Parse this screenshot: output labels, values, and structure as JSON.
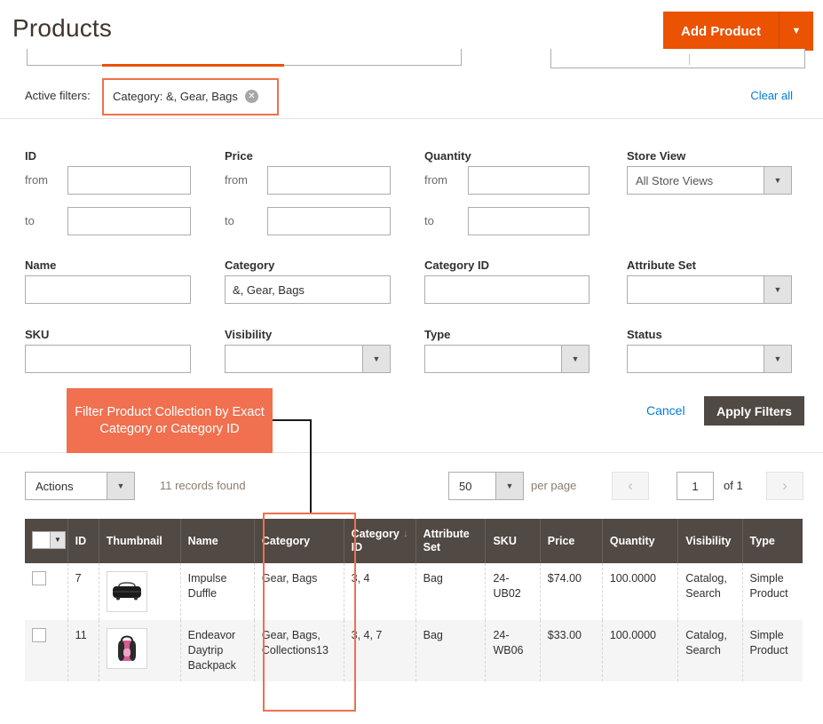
{
  "header": {
    "title": "Products",
    "add_product_label": "Add Product",
    "caret_icon": "chevron-down-icon"
  },
  "active_filters": {
    "label": "Active filters:",
    "chips": [
      {
        "text": "Category: &, Gear, Bags",
        "remove_icon": "close-icon"
      }
    ],
    "clear_all_label": "Clear all"
  },
  "filters": {
    "id": {
      "label": "ID",
      "from_label": "from",
      "to_label": "to",
      "from_value": "",
      "to_value": ""
    },
    "price": {
      "label": "Price",
      "from_label": "from",
      "to_label": "to",
      "from_value": "",
      "to_value": ""
    },
    "quantity": {
      "label": "Quantity",
      "from_label": "from",
      "to_label": "to",
      "from_value": "",
      "to_value": ""
    },
    "store_view": {
      "label": "Store View",
      "value": "All Store Views"
    },
    "name": {
      "label": "Name",
      "value": ""
    },
    "category": {
      "label": "Category",
      "value": "&, Gear, Bags"
    },
    "category_id": {
      "label": "Category ID",
      "value": ""
    },
    "attribute_set": {
      "label": "Attribute Set",
      "value": ""
    },
    "sku": {
      "label": "SKU",
      "value": ""
    },
    "visibility": {
      "label": "Visibility",
      "value": ""
    },
    "type": {
      "label": "Type",
      "value": ""
    },
    "status": {
      "label": "Status",
      "value": ""
    },
    "cancel_label": "Cancel",
    "apply_label": "Apply Filters"
  },
  "callout": {
    "text": "Filter Product Collection by Exact Category or Category ID",
    "color": "#f0704f"
  },
  "toolbar": {
    "actions_label": "Actions",
    "records_found": "11 records found",
    "per_page_value": "50",
    "per_page_label": "per page",
    "page_value": "1",
    "of_pages": "of 1",
    "prev_icon": "chevron-left-icon",
    "next_icon": "chevron-right-icon"
  },
  "grid": {
    "columns": [
      "",
      "ID",
      "Thumbnail",
      "Name",
      "Category",
      "Category ID",
      "Attribute Set",
      "SKU",
      "Price",
      "Quantity",
      "Visibility",
      "Type"
    ],
    "sorted_column": "Category ID",
    "sort_direction_icon": "arrow-down-icon",
    "rows": [
      {
        "id": "7",
        "thumbnail_alt": "duffle-bag-thumbnail",
        "name": "Impulse Duffle",
        "category": "Gear, Bags",
        "category_id": "3, 4",
        "attribute_set": "Bag",
        "sku": "24-UB02",
        "price": "$74.00",
        "quantity": "100.0000",
        "visibility": "Catalog, Search",
        "type": "Simple Product"
      },
      {
        "id": "11",
        "thumbnail_alt": "backpack-thumbnail",
        "name": "Endeavor Daytrip Backpack",
        "category": "Gear, Bags, Collections13",
        "category_id": "3, 4, 7",
        "attribute_set": "Bag",
        "sku": "24-WB06",
        "price": "$33.00",
        "quantity": "100.0000",
        "visibility": "Catalog, Search",
        "type": "Simple Product"
      }
    ]
  },
  "colors": {
    "accent_orange": "#eb5202",
    "annotation_orange": "#f0704f",
    "header_brown": "#514943",
    "link_blue": "#007bdb"
  }
}
